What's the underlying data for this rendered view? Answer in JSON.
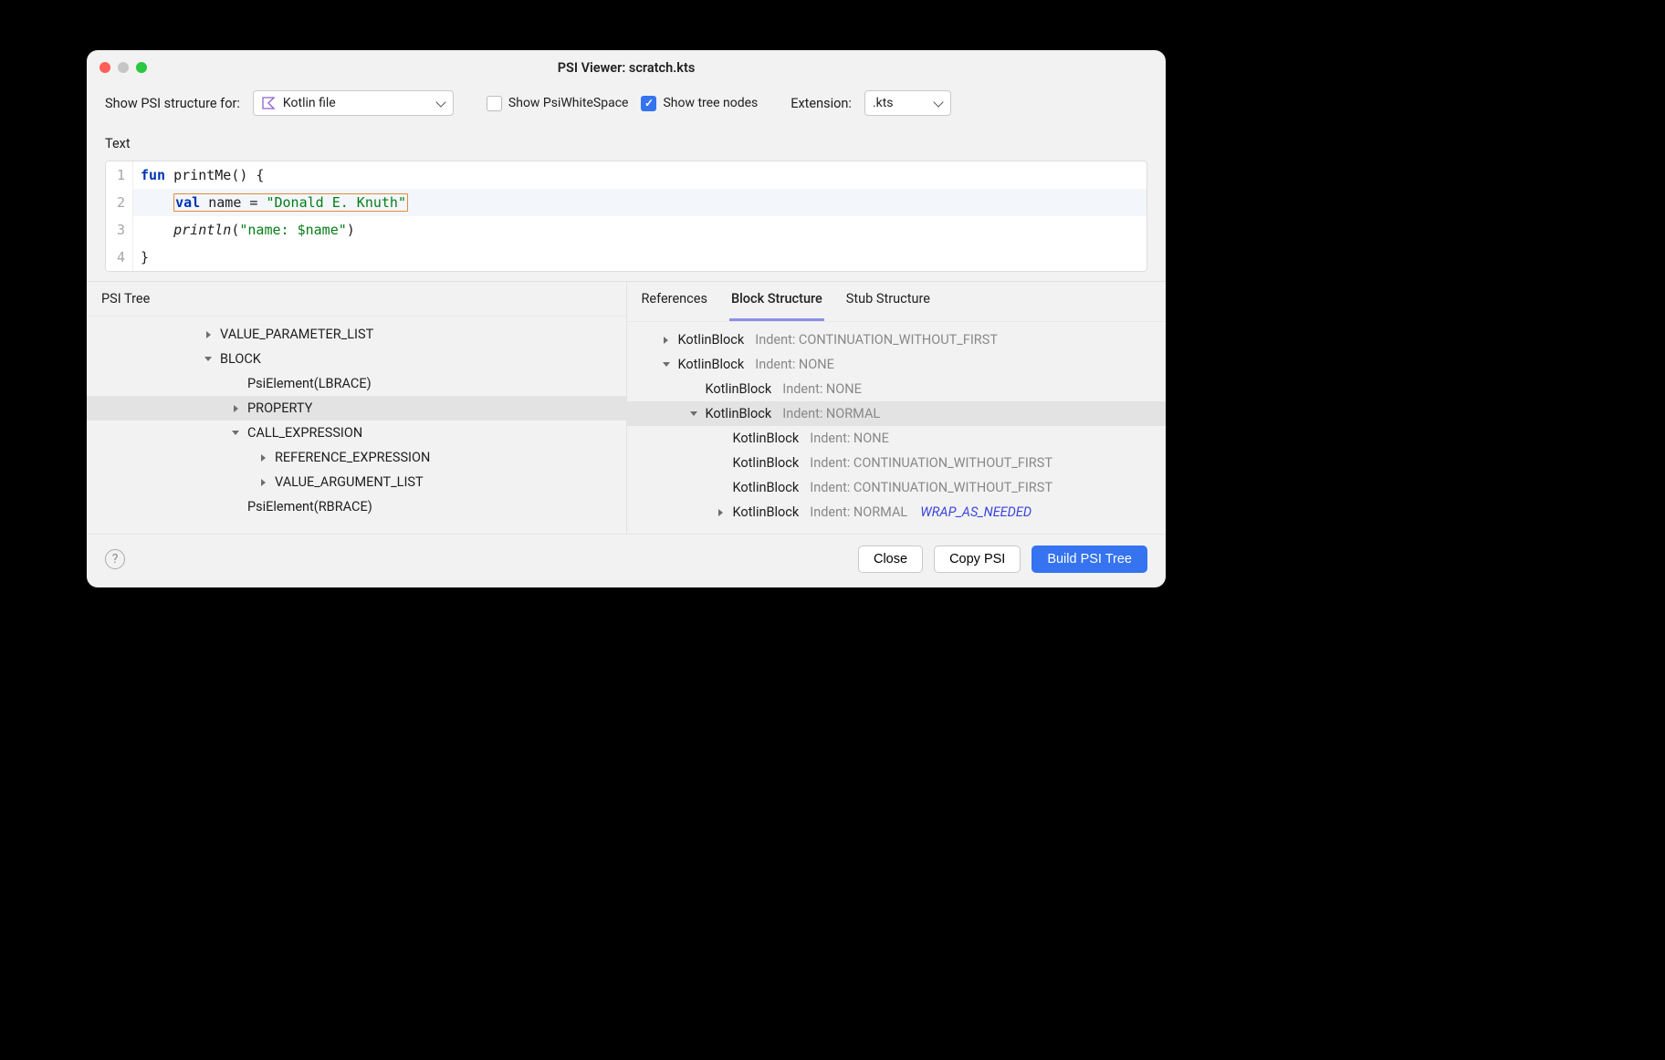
{
  "window": {
    "title": "PSI Viewer: scratch.kts"
  },
  "toolbar": {
    "showPsiLabel": "Show PSI structure for:",
    "fileTypeSelect": "Kotlin file",
    "showWhitespaceLabel": "Show PsiWhiteSpace",
    "showTreeNodesLabel": "Show tree nodes",
    "extensionLabel": "Extension:",
    "extensionValue": ".kts"
  },
  "text": {
    "sectionLabel": "Text",
    "lines": {
      "l1": {
        "num": "1",
        "kw": "fun",
        "name": " printMe",
        "rest": "() {"
      },
      "l2": {
        "num": "2",
        "indent": "    ",
        "kw": "val",
        "name": " name = ",
        "str": "\"Donald E. Knuth\""
      },
      "l3": {
        "num": "3",
        "indent": "    ",
        "call": "println",
        "open": "(",
        "str": "\"name: ",
        "interp": "$name",
        "strEnd": "\"",
        "close": ")"
      },
      "l4": {
        "num": "4",
        "rest": "}"
      }
    }
  },
  "psiTree": {
    "label": "PSI Tree",
    "rows": [
      {
        "indent": 120,
        "arrow": "right",
        "text": "VALUE_PARAMETER_LIST",
        "selected": false
      },
      {
        "indent": 120,
        "arrow": "down",
        "text": "BLOCK",
        "selected": false
      },
      {
        "indent": 150,
        "arrow": "none",
        "text": "PsiElement(LBRACE)",
        "selected": false
      },
      {
        "indent": 150,
        "arrow": "right",
        "text": "PROPERTY",
        "selected": true
      },
      {
        "indent": 150,
        "arrow": "down",
        "text": "CALL_EXPRESSION",
        "selected": false
      },
      {
        "indent": 180,
        "arrow": "right",
        "text": "REFERENCE_EXPRESSION",
        "selected": false
      },
      {
        "indent": 180,
        "arrow": "right",
        "text": "VALUE_ARGUMENT_LIST",
        "selected": false
      },
      {
        "indent": 150,
        "arrow": "none",
        "text": "PsiElement(RBRACE)",
        "selected": false
      }
    ]
  },
  "detailTabs": {
    "references": "References",
    "block": "Block Structure",
    "stub": "Stub Structure"
  },
  "blockTree": {
    "rows": [
      {
        "indent": 30,
        "arrow": "right",
        "name": "KotlinBlock",
        "sec": "Indent: CONTINUATION_WITHOUT_FIRST",
        "selected": false
      },
      {
        "indent": 30,
        "arrow": "down",
        "name": "KotlinBlock",
        "sec": "Indent: NONE",
        "selected": false
      },
      {
        "indent": 60,
        "arrow": "none",
        "name": "KotlinBlock",
        "sec": "Indent: NONE",
        "selected": false
      },
      {
        "indent": 60,
        "arrow": "down",
        "name": "KotlinBlock",
        "sec": "Indent: NORMAL",
        "selected": true
      },
      {
        "indent": 90,
        "arrow": "none",
        "name": "KotlinBlock",
        "sec": "Indent: NONE",
        "selected": false
      },
      {
        "indent": 90,
        "arrow": "none",
        "name": "KotlinBlock",
        "sec": "Indent: CONTINUATION_WITHOUT_FIRST",
        "selected": false
      },
      {
        "indent": 90,
        "arrow": "none",
        "name": "KotlinBlock",
        "sec": "Indent: CONTINUATION_WITHOUT_FIRST",
        "selected": false
      },
      {
        "indent": 90,
        "arrow": "right",
        "name": "KotlinBlock",
        "sec": "Indent: NORMAL",
        "wrap": "WRAP_AS_NEEDED",
        "selected": false
      }
    ]
  },
  "footer": {
    "close": "Close",
    "copy": "Copy PSI",
    "build": "Build PSI Tree"
  }
}
